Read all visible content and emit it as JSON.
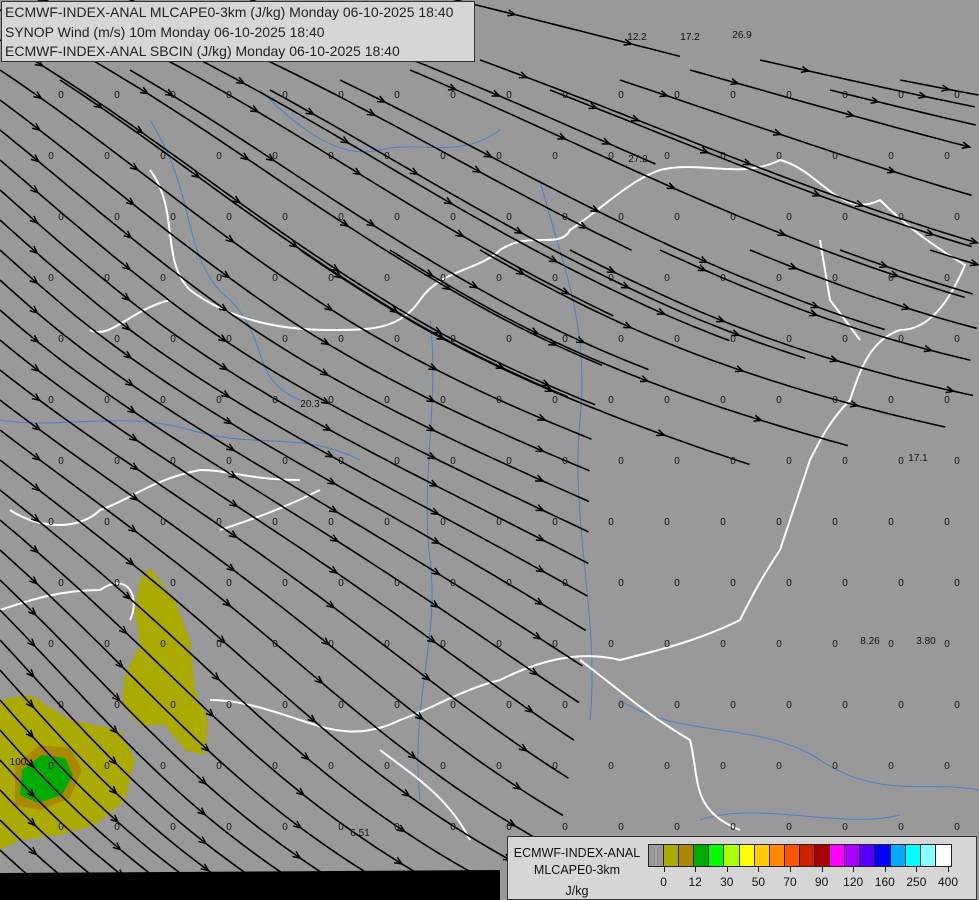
{
  "header": {
    "lines": [
      "ECMWF-INDEX-ANAL MLCAPE0-3km (J/kg) Monday 06-10-2025 18:40",
      "SYNOP Wind (m/s) 10m Monday 06-10-2025 18:40",
      "ECMWF-INDEX-ANAL SBCIN (J/kg) Monday 06-10-2025 18:40"
    ]
  },
  "map": {
    "background_color": "#999999",
    "border_color": "#ffffff",
    "river_color": "#4a7fc8",
    "streamline_color": "#000000",
    "zero_label": "0",
    "value_labels": [
      "12.2",
      "17.2",
      "26.9",
      "27.2",
      "20.3",
      "17.1",
      "8.26",
      "3.80",
      "6.51",
      "100"
    ],
    "cape_fill_colors": [
      "#aaaa00",
      "#aa8800",
      "#00aa00"
    ]
  },
  "legend": {
    "title_lines": [
      "ECMWF-INDEX-ANAL",
      "MLCAPE0-3km",
      "J/kg"
    ],
    "colors": [
      "#999999",
      "#aaaa00",
      "#aa8800",
      "#00aa00",
      "#00ff00",
      "#aaff00",
      "#ffff00",
      "#ffcc00",
      "#ff8800",
      "#ff5500",
      "#cc2200",
      "#aa0000",
      "#ff00ff",
      "#aa00ff",
      "#5500ff",
      "#0000ff",
      "#00aaff",
      "#00ffff",
      "#88ffff",
      "#ffffff"
    ],
    "tick_labels": [
      "0",
      "12",
      "30",
      "50",
      "70",
      "90",
      "120",
      "160",
      "250",
      "400"
    ]
  }
}
